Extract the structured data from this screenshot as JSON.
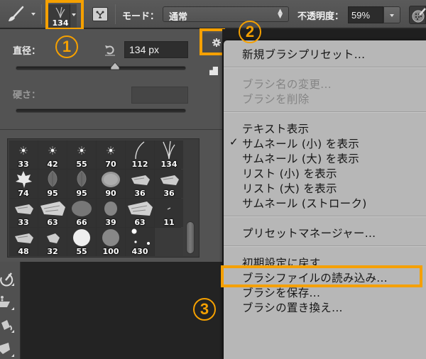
{
  "toolbar": {
    "brush_size_preview": "134",
    "mode_label": "モード：",
    "mode_value": "通常",
    "opacity_label": "不透明度：",
    "opacity_value": "59%"
  },
  "brush_panel": {
    "diameter_label": "直径：",
    "diameter_value": "134 px",
    "diameter_slider_fraction": 0.58,
    "hardness_label": "硬さ：",
    "hardness_value": "",
    "presets": [
      {
        "size": "33",
        "type": "soft-star"
      },
      {
        "size": "42",
        "type": "soft-star"
      },
      {
        "size": "55",
        "type": "soft-star"
      },
      {
        "size": "70",
        "type": "soft-star"
      },
      {
        "size": "112",
        "type": "grass-single"
      },
      {
        "size": "134",
        "type": "grass-multi"
      },
      {
        "size": "74",
        "type": "maple-leaf"
      },
      {
        "size": "95",
        "type": "leaf"
      },
      {
        "size": "95",
        "type": "leaf"
      },
      {
        "size": "90",
        "type": "speckle-dense"
      },
      {
        "size": "36",
        "type": "chalk"
      },
      {
        "size": "36",
        "type": "chalk"
      },
      {
        "size": "33",
        "type": "chalk"
      },
      {
        "size": "63",
        "type": "chalk-large"
      },
      {
        "size": "66",
        "type": "spatter"
      },
      {
        "size": "39",
        "type": "spatter-small"
      },
      {
        "size": "63",
        "type": "chalk-large"
      },
      {
        "size": "11",
        "type": "tiny"
      },
      {
        "size": "48",
        "type": "chalk"
      },
      {
        "size": "32",
        "type": "chalk-small"
      },
      {
        "size": "55",
        "type": "hard-round"
      },
      {
        "size": "100",
        "type": "speckle-round"
      },
      {
        "size": "430",
        "type": "dots"
      },
      {
        "size": "",
        "type": "empty"
      }
    ]
  },
  "menu": {
    "groups": [
      [
        {
          "label": "新規ブラシプリセット...",
          "disabled": false
        }
      ],
      [
        {
          "label": "ブラシ名の変更...",
          "disabled": true
        },
        {
          "label": "ブラシを削除",
          "disabled": true
        }
      ],
      [
        {
          "label": "テキスト表示",
          "disabled": false
        },
        {
          "label": "サムネール (小) を表示",
          "disabled": false,
          "checked": true
        },
        {
          "label": "サムネール (大) を表示",
          "disabled": false
        },
        {
          "label": "リスト (小) を表示",
          "disabled": false
        },
        {
          "label": "リスト (大) を表示",
          "disabled": false
        },
        {
          "label": "サムネール (ストローク)",
          "disabled": false
        }
      ],
      [
        {
          "label": "プリセットマネージャー...",
          "disabled": false
        }
      ],
      [
        {
          "label": "初期設定に戻す...",
          "disabled": false
        },
        {
          "label": "ブラシファイルの読み込み...",
          "disabled": false,
          "highlighted": true
        },
        {
          "label": "ブラシを保存...",
          "disabled": false
        },
        {
          "label": "ブラシの置き換え...",
          "disabled": false
        }
      ]
    ],
    "check_mark": "✓"
  },
  "callouts": [
    "1",
    "2",
    "3"
  ],
  "colors": {
    "highlight": "#f5a000",
    "panel_bg": "#535353",
    "menu_bg": "#b7b7b7"
  }
}
